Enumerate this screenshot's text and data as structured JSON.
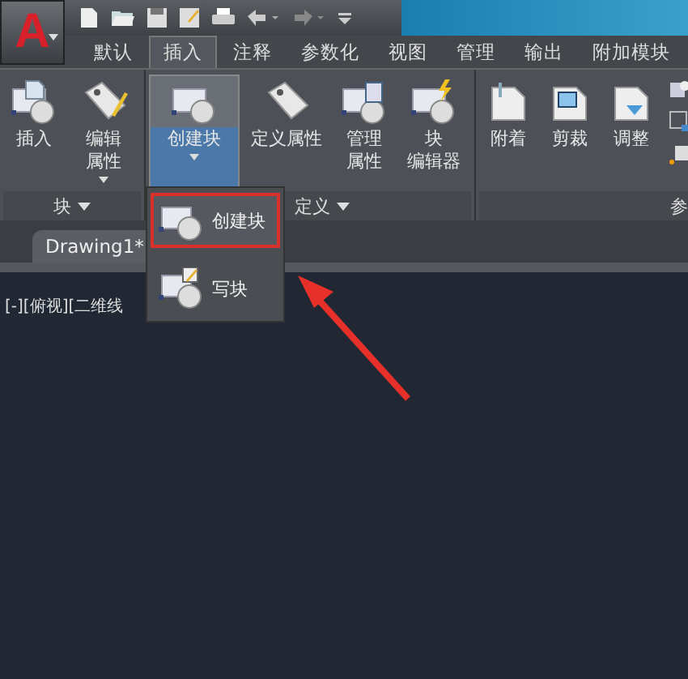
{
  "app_menu": {
    "label": "A"
  },
  "tabs": [
    {
      "label": "默认",
      "selected": false
    },
    {
      "label": "插入",
      "selected": true
    },
    {
      "label": "注释",
      "selected": false
    },
    {
      "label": "参数化",
      "selected": false
    },
    {
      "label": "视图",
      "selected": false
    },
    {
      "label": "管理",
      "selected": false
    },
    {
      "label": "输出",
      "selected": false
    },
    {
      "label": "附加模块",
      "selected": false
    }
  ],
  "ribbon": {
    "panels": [
      {
        "label": "块",
        "has_dropdown": true,
        "buttons": [
          {
            "lines": [
              "插入"
            ],
            "has_dropdown": false,
            "selected": false
          },
          {
            "lines": [
              "编辑",
              "属性"
            ],
            "has_dropdown": true,
            "selected": false
          }
        ]
      },
      {
        "label": "定义",
        "has_dropdown": true,
        "buttons": [
          {
            "lines": [
              "创建块"
            ],
            "has_dropdown": true,
            "selected": true
          },
          {
            "lines": [
              "定义属性"
            ],
            "has_dropdown": false,
            "selected": false
          },
          {
            "lines": [
              "管理",
              "属性"
            ],
            "has_dropdown": false,
            "selected": false
          },
          {
            "lines": [
              "块",
              "编辑器"
            ],
            "has_dropdown": false,
            "selected": false
          }
        ]
      },
      {
        "label": "参",
        "has_dropdown": false,
        "buttons": [
          {
            "lines": [
              "附着"
            ],
            "has_dropdown": false,
            "selected": false
          },
          {
            "lines": [
              "剪裁"
            ],
            "has_dropdown": false,
            "selected": false
          },
          {
            "lines": [
              "调整"
            ],
            "has_dropdown": false,
            "selected": false
          }
        ]
      }
    ]
  },
  "document_tab": {
    "label": "Drawing1*"
  },
  "viewport_label": "[-][俯视][二维线",
  "dropdown_menu": {
    "items": [
      {
        "label": "创建块",
        "selected": true
      },
      {
        "label": "写块",
        "selected": false
      }
    ]
  }
}
